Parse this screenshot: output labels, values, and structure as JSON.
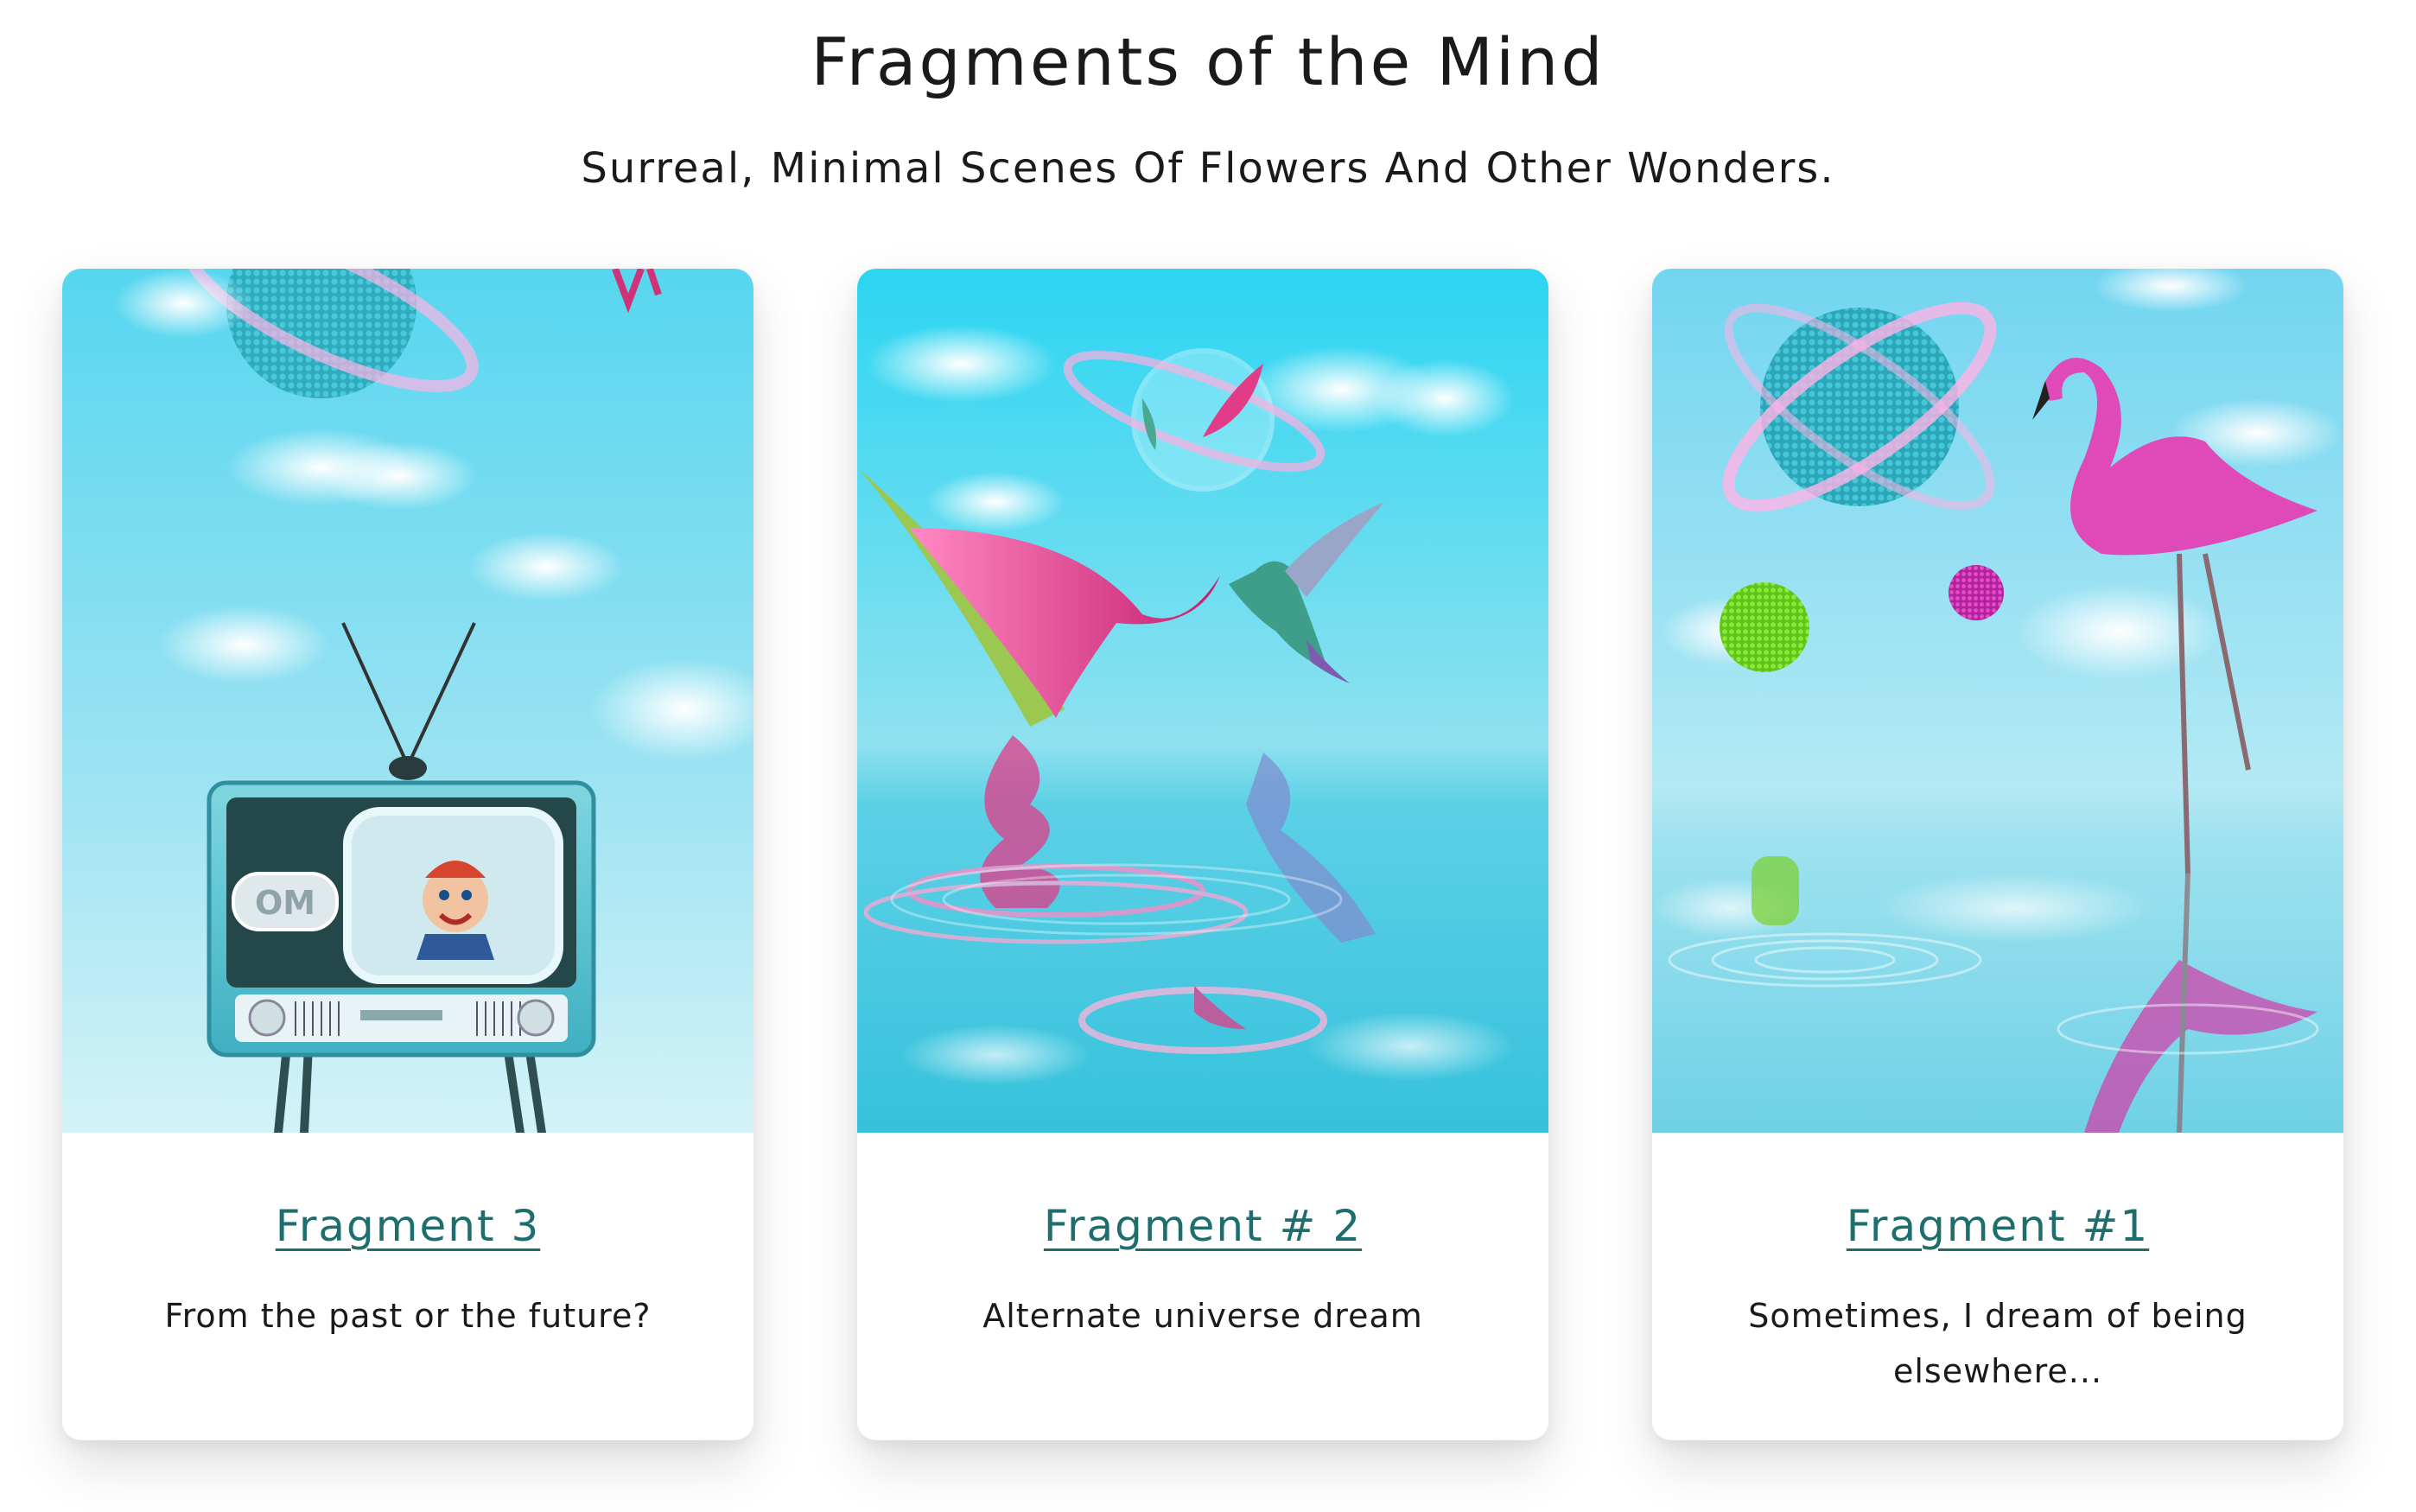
{
  "header": {
    "title": "Fragments of the Mind",
    "subtitle": "Surreal, Minimal Scenes Of Flowers And Other Wonders."
  },
  "cards": [
    {
      "title": "Fragment 3",
      "description": "From the past or the future?",
      "image": "retro-tv-puppet-sky-scene",
      "tv_badge": "OM"
    },
    {
      "title": "Fragment # 2",
      "description": "Alternate universe dream",
      "image": "hummingbird-lily-water-reflection-scene"
    },
    {
      "title": "Fragment #1",
      "description": "Sometimes, I dream of being elsewhere...",
      "image": "flamingo-planet-water-reflection-scene"
    }
  ],
  "colors": {
    "link": "#1f6e6e",
    "sky_top": "#2fd3ee",
    "sky_bottom": "#c8eef5",
    "accent_pink": "#e0409a",
    "accent_green": "#7ed321"
  }
}
